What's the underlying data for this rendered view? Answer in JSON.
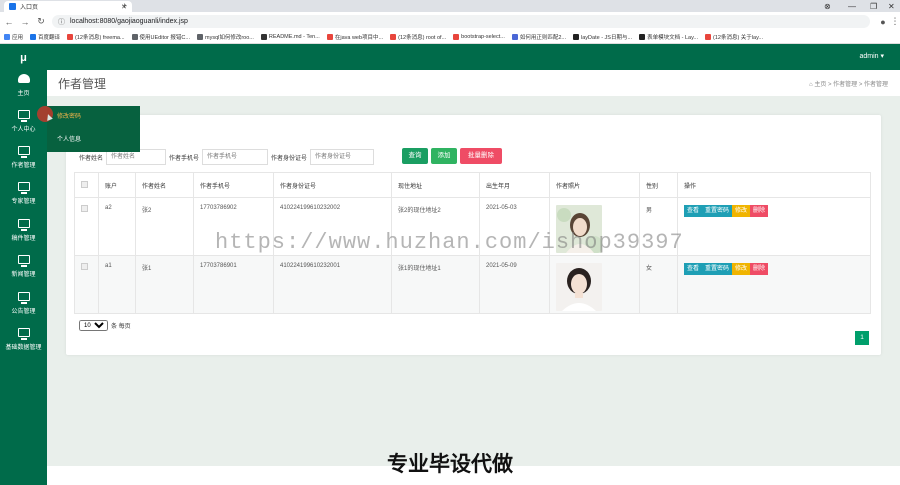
{
  "browser": {
    "tab_title": "入口页",
    "url": "localhost:8080/gaojiaoguanli/index.jsp",
    "bookmarks": [
      "应用",
      "百度翻译",
      "(12条消息) freema...",
      "使用UEditor 报错C...",
      "mysql如何修改roo...",
      "README.md - Ten...",
      "在java web项目中...",
      "(12条消息) root of...",
      "bootstrap-select...",
      "如何用正则匹配2...",
      "layDate - JS日期与...",
      "表单模块文档 - Lay...",
      "(12条消息) 关于lay..."
    ]
  },
  "sidebar": {
    "logo": "μ",
    "items": [
      {
        "label": "主页"
      },
      {
        "label": "个人中心"
      },
      {
        "label": "作者管理"
      },
      {
        "label": "专家管理"
      },
      {
        "label": "稿件管理"
      },
      {
        "label": "新闻管理"
      },
      {
        "label": "公告管理"
      },
      {
        "label": "基础数据管理"
      }
    ]
  },
  "submenu": {
    "items": [
      "修改密码",
      "个人信息"
    ]
  },
  "topbar": {
    "user": "admin ▾"
  },
  "header": {
    "title": "作者管理",
    "breadcrumb": "⌂ 主页  >  作者管理  >  作者管理"
  },
  "search": {
    "name_label": "作者姓名",
    "name_placeholder": "作者姓名",
    "phone_label": "作者手机号",
    "phone_placeholder": "作者手机号",
    "id_label": "作者身份证号",
    "id_placeholder": "作者身份证号",
    "query_btn": "查询",
    "add_btn": "添加",
    "batch_delete_btn": "批量删除"
  },
  "table": {
    "headers": [
      "",
      "账户",
      "作者姓名",
      "作者手机号",
      "作者身份证号",
      "现住地址",
      "出生年月",
      "作者照片",
      "性别",
      "操作"
    ],
    "rows": [
      {
        "account": "a2",
        "name": "张2",
        "phone": "17703786902",
        "idcard": "410224199610232002",
        "address": "张2的现住地址2",
        "birth": "2021-05-03",
        "gender": "男"
      },
      {
        "account": "a1",
        "name": "张1",
        "phone": "17703786901",
        "idcard": "410224199610232001",
        "address": "张1的现住地址1",
        "birth": "2021-05-09",
        "gender": "女"
      }
    ],
    "actions": {
      "view": "查看",
      "reset": "重置密码",
      "edit": "修改",
      "delete": "删除"
    }
  },
  "pager": {
    "page_size": "10",
    "per_page_label": "条 每页",
    "current_page": "1"
  },
  "overlay": {
    "watermark": "https://www.huzhan.com/ishop39397",
    "banner": "专业毕设代做"
  },
  "colors": {
    "primary": "#006b4a",
    "btn_blue": "#1e9fb5",
    "btn_green": "#2fb361",
    "btn_red": "#ef4c65",
    "btn_orange": "#f0b400"
  }
}
